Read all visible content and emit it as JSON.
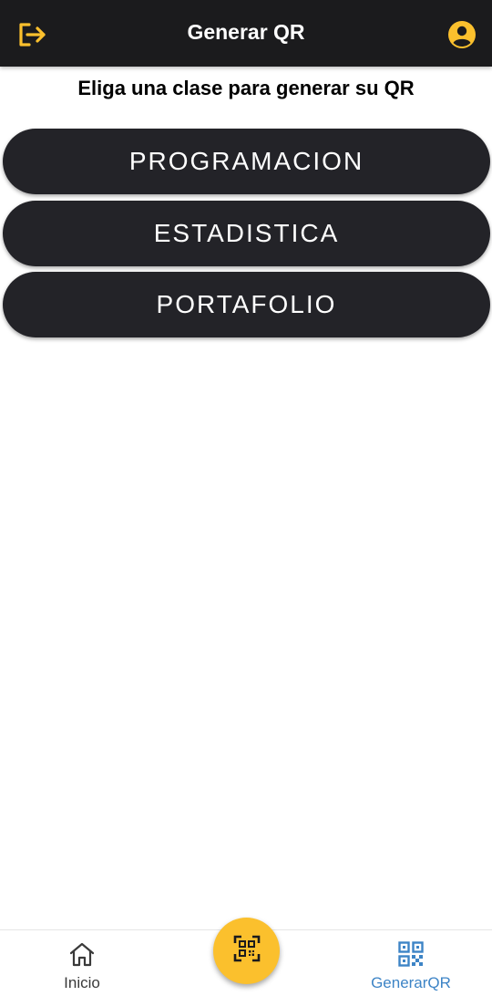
{
  "colors": {
    "appbar": "#1b1b1d",
    "accent": "#fbc02d",
    "button": "#232328",
    "active_nav": "#3d84c6"
  },
  "header": {
    "title": "Generar QR",
    "left_icon": "logout-icon",
    "right_icon": "account-circle-icon"
  },
  "main": {
    "subtitle": "Eliga una clase para generar su QR",
    "classes": [
      {
        "label": "PROGRAMACION"
      },
      {
        "label": "ESTADISTICA"
      },
      {
        "label": "PORTAFOLIO"
      }
    ]
  },
  "bottom_nav": {
    "items": [
      {
        "label": "Inicio",
        "icon": "home-icon",
        "active": false
      },
      {
        "label": "GenerarQR",
        "icon": "qr-code-icon",
        "active": true
      }
    ],
    "fab_icon": "qr-scan-icon"
  }
}
